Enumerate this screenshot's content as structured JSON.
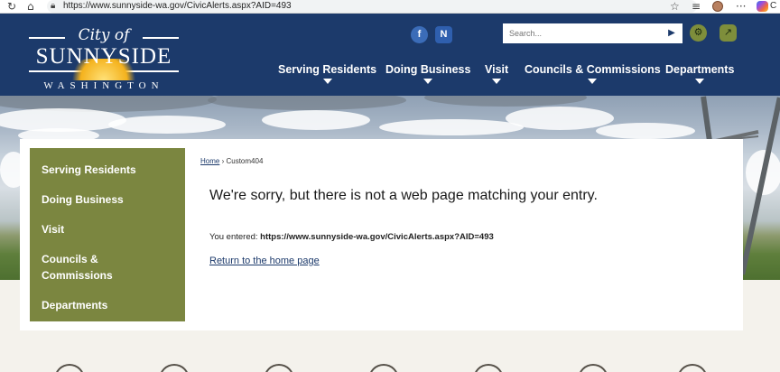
{
  "browser": {
    "url": "https://www.sunnyside-wa.gov/CivicAlerts.aspx?AID=493",
    "tab_fragment": "C"
  },
  "header": {
    "logo": {
      "line1": "City of",
      "line2": "SUNNYSIDE",
      "line3": "WASHINGTON"
    },
    "search_placeholder": "Search...",
    "social": {
      "facebook": "f",
      "notify": "N"
    },
    "nav": [
      {
        "label": "Serving Residents"
      },
      {
        "label": "Doing Business"
      },
      {
        "label": "Visit"
      },
      {
        "label": "Councils & Commissions"
      },
      {
        "label": "Departments"
      }
    ]
  },
  "sidebar": {
    "items": [
      {
        "label": "Serving Residents"
      },
      {
        "label": "Doing Business"
      },
      {
        "label": "Visit"
      },
      {
        "label": "Councils &"
      },
      {
        "label": "Commissions"
      },
      {
        "label": "Departments"
      }
    ]
  },
  "main": {
    "breadcrumb": {
      "home": "Home",
      "separator": "›",
      "current": "Custom404"
    },
    "heading": "We're sorry, but there is not a web page matching your entry.",
    "entered_label": "You entered:",
    "entered_value": "https://www.sunnyside-wa.gov/CivicAlerts.aspx?AID=493",
    "home_link": "Return to the home page"
  },
  "colors": {
    "header_bg": "#1c3a6b",
    "sidebar_bg": "#7b8640",
    "accent_olive": "#7e8e3b",
    "link": "#1c3a6b"
  }
}
